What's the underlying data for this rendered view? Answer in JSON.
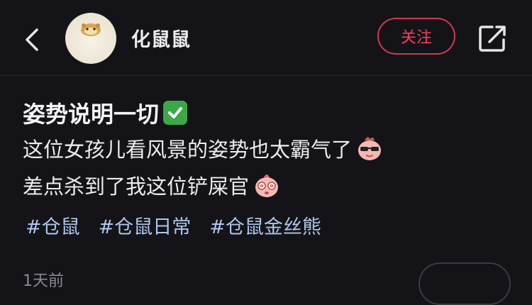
{
  "header": {
    "username": "化鼠鼠",
    "follow_label": "关注",
    "icons": {
      "back": "chevron-left-icon",
      "share": "share-icon"
    },
    "accent_color": "#f0425c"
  },
  "post": {
    "title": "姿势说明一切",
    "title_emoji": "check-mark-icon",
    "line1": "这位女孩儿看风景的姿势也太霸气了",
    "line2": "差点杀到了我这位铲屎官",
    "tags": [
      "#仓鼠",
      "#仓鼠日常",
      "#仓鼠金丝熊"
    ],
    "time": "1天前"
  }
}
